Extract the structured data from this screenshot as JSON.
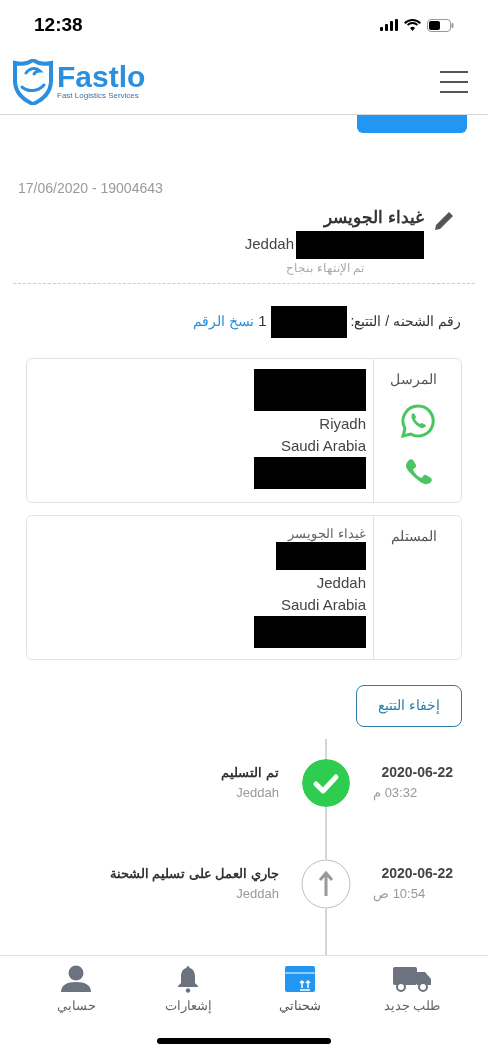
{
  "status_bar": {
    "time": "12:38"
  },
  "header": {
    "logo_name": "Fastlo",
    "logo_tagline": "Fast Logistics Services"
  },
  "shipment": {
    "date_id": "17/06/2020 - 19004643",
    "recipient_name": "غيداء الجويسر",
    "city": "Jeddah",
    "status": "تم الإنتهاء بنجاح",
    "tracking_label": "رقم الشحنه / التتبع:",
    "tracking_digit": "1",
    "copy_link": "نسخ الرقم"
  },
  "parties": [
    {
      "role": "المرسل",
      "city": "Riyadh",
      "country": "Saudi Arabia",
      "contacts": true
    },
    {
      "role": "المستلم",
      "name": "غيداء الجويسر",
      "city": "Jeddah",
      "country": "Saudi Arabia",
      "contacts": false
    }
  ],
  "hide_tracking_button": "إخفاء التتبع",
  "timeline": [
    {
      "date": "2020-06-22",
      "time": "03:32 م",
      "title": "تم التسليم",
      "city": "Jeddah",
      "kind": "done"
    },
    {
      "date": "2020-06-22",
      "time": "10:54 ص",
      "title": "جاري العمل على تسليم الشحنة",
      "city": "Jeddah",
      "kind": "progress"
    }
  ],
  "nav": [
    {
      "label": "طلب جديد",
      "kind": "truck",
      "selected": false
    },
    {
      "label": "شحناتي",
      "kind": "box",
      "selected": true
    },
    {
      "label": "إشعارات",
      "kind": "bell",
      "selected": false
    },
    {
      "label": "حسابي",
      "kind": "user",
      "selected": false
    }
  ]
}
